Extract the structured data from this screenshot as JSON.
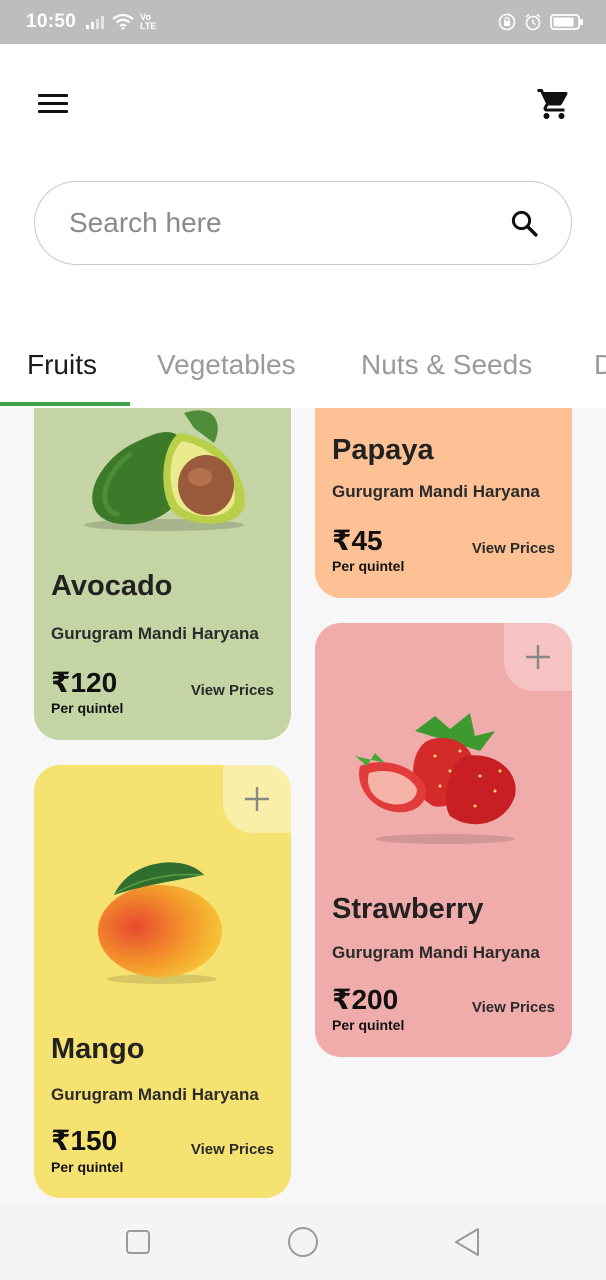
{
  "status": {
    "time": "10:50",
    "network_label": "Vo LTE"
  },
  "header": {
    "menu_icon": "hamburger-menu-icon",
    "cart_icon": "shopping-cart-icon"
  },
  "search": {
    "placeholder": "Search here",
    "value": ""
  },
  "tabs": [
    {
      "label": "Fruits",
      "active": true
    },
    {
      "label": "Vegetables",
      "active": false
    },
    {
      "label": "Nuts & Seeds",
      "active": false
    },
    {
      "label": "D",
      "active": false
    }
  ],
  "accent_color": "#43a047",
  "products": {
    "avocado": {
      "name": "Avocado",
      "market": "Gurugram Mandi Haryana",
      "price": "₹120",
      "unit": "Per quintel",
      "action": "View Prices",
      "color": "#c5d4a4"
    },
    "papaya": {
      "name": "Papaya",
      "market": "Gurugram Mandi Haryana",
      "price": "₹45",
      "unit": "Per quintel",
      "action": "View Prices",
      "color": "#fec195"
    },
    "strawberry": {
      "name": "Strawberry",
      "market": "Gurugram Mandi Haryana",
      "price": "₹200",
      "unit": "Per quintel",
      "action": "View Prices",
      "color": "#f0abab"
    },
    "mango": {
      "name": "Mango",
      "market": "Gurugram Mandi Haryana",
      "price": "₹150",
      "unit": "Per quintel",
      "action": "View Prices",
      "color": "#f6e271"
    }
  }
}
